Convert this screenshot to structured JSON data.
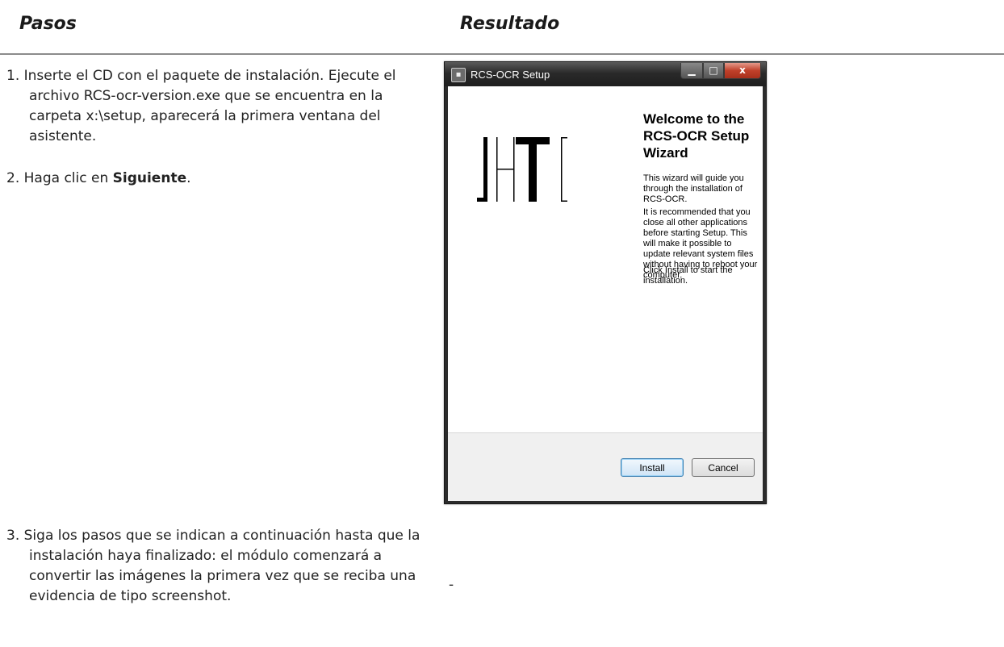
{
  "headers": {
    "col1": "Pasos",
    "col2": "Resultado"
  },
  "steps": [
    {
      "num": "1.",
      "text": "Inserte el CD con el paquete de instalación. Ejecute el archivo RCS-ocr-version.exe que se encuentra en la carpeta x:\\setup, aparecerá la primera ventana del asistente."
    },
    {
      "num": "2.",
      "text_before": "Haga clic en ",
      "bold": "Siguiente",
      "text_after": "."
    },
    {
      "num": "3.",
      "text": "Siga los pasos que se indican a continuación hasta que la instalación haya finalizado: el módulo comenzará a convertir las imágenes la primera vez que se reciba una evidencia de tipo screenshot."
    }
  ],
  "step3_result": "-",
  "window": {
    "title": "RCS-OCR Setup",
    "close_glyph": "x",
    "welcome_title": "Welcome to the RCS-OCR Setup Wizard",
    "paragraphs": [
      "This wizard will guide you through the installation of RCS-OCR.",
      "It is recommended that you close all other applications before starting Setup. This will make it possible to update relevant system files without having to reboot your computer.",
      "Click Install to start the installation."
    ],
    "buttons": {
      "install": "Install",
      "cancel": "Cancel"
    }
  }
}
